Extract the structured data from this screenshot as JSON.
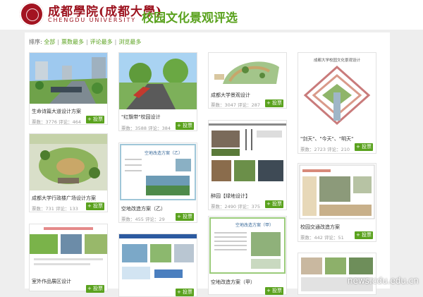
{
  "header": {
    "logo_cn": "成都學院(成都大學)",
    "logo_en": "CHENGDU UNIVERSITY",
    "site_title": "校园文化景观评选"
  },
  "sort": {
    "label": "排序:",
    "options": [
      "全部",
      "票数最多",
      "评论最多",
      "浏览最多"
    ]
  },
  "cards": [
    {
      "title": "生命诗篇大道设计方案",
      "votes": "票数：3776",
      "comments": "评论：464",
      "button": "+ 投票"
    },
    {
      "title": "\"红飘带\"校园设计",
      "votes": "票数：3588",
      "comments": "评论：384",
      "button": "+ 投票"
    },
    {
      "title": "成都大学景观设计",
      "votes": "票数：3047",
      "comments": "评论：287",
      "button": "+ 投票"
    },
    {
      "title": "\"剑天\"、\"今天\"、\"明天\"",
      "votes": "票数：2723",
      "comments": "评论：210",
      "button": "+ 投票"
    },
    {
      "title": "成都大学行政楼广场设计方案",
      "votes": "票数：731",
      "comments": "评论：133",
      "button": "+ 投票"
    },
    {
      "title": "空地改造方案（乙）",
      "votes": "票数：455",
      "comments": "评论：29",
      "button": "+ 投票"
    },
    {
      "title": "醉园【绿地设计】",
      "votes": "票数：2490",
      "comments": "评论：375",
      "button": "+ 投票"
    },
    {
      "title": "校园交通改造方案",
      "votes": "票数：442",
      "comments": "评论：51",
      "button": "+ 投票"
    },
    {
      "title": "室外作品展区设计",
      "votes": "",
      "comments": "",
      "button": "+ 投票"
    },
    {
      "title": "",
      "votes": "",
      "comments": "",
      "button": "+ 投票"
    },
    {
      "title": "空地改造方案（甲）",
      "votes": "",
      "comments": "",
      "button": "+ 投票"
    },
    {
      "title": "",
      "votes": "",
      "comments": "",
      "button": ""
    }
  ],
  "thumb_texts": [
    "成都大学校园文化景观设计",
    "空地改造方案（乙）",
    "空地改造方案（甲）"
  ],
  "watermark": "news.cdu.edu.cn",
  "colors": {
    "brand_red": "#9d1420",
    "accent_green": "#5aa21e"
  }
}
